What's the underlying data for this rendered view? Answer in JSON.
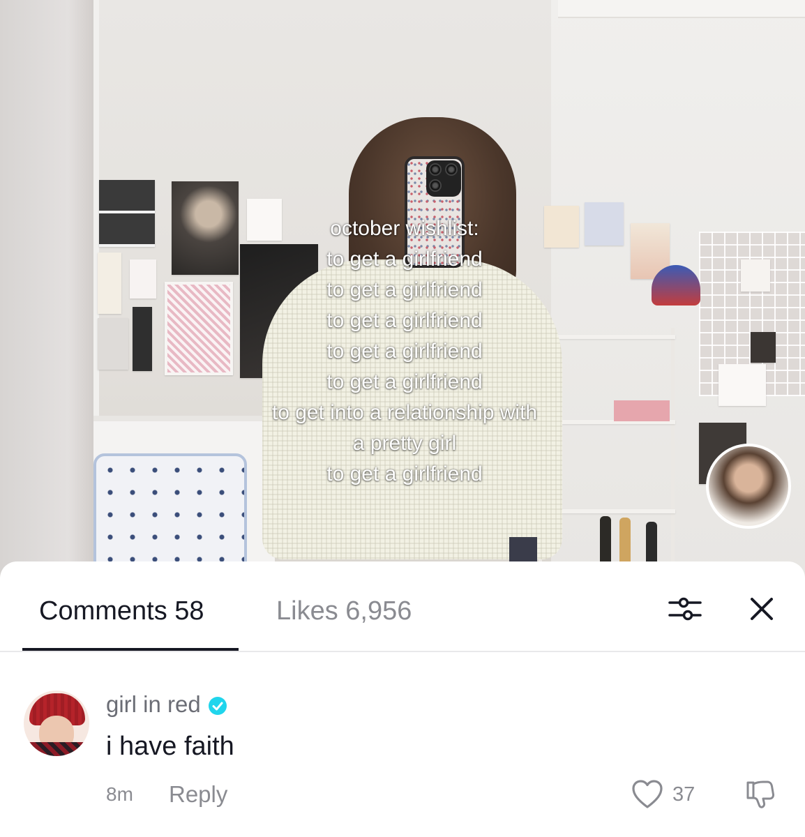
{
  "video": {
    "overlay_lines": [
      "october wishlist:",
      "to get a girlfriend",
      "to get a girlfriend",
      "to get a girlfriend",
      "to get a girlfriend",
      "to get a girlfriend",
      "to get into a relationship with",
      "a pretty girl",
      "to get a girlfriend"
    ]
  },
  "sheet": {
    "tabs": [
      {
        "label": "Comments 58",
        "active": true
      },
      {
        "label": "Likes 6,956",
        "active": false
      }
    ],
    "icons": {
      "filter": "sliders-icon",
      "close": "close-icon"
    }
  },
  "comment": {
    "username": "girl in red",
    "verified": true,
    "text": "i have faith",
    "time": "8m",
    "reply_label": "Reply",
    "like_count": "37"
  },
  "colors": {
    "primary_text": "#161823",
    "secondary_text": "#8a8b91",
    "verified_badge": "#20d5ec"
  }
}
